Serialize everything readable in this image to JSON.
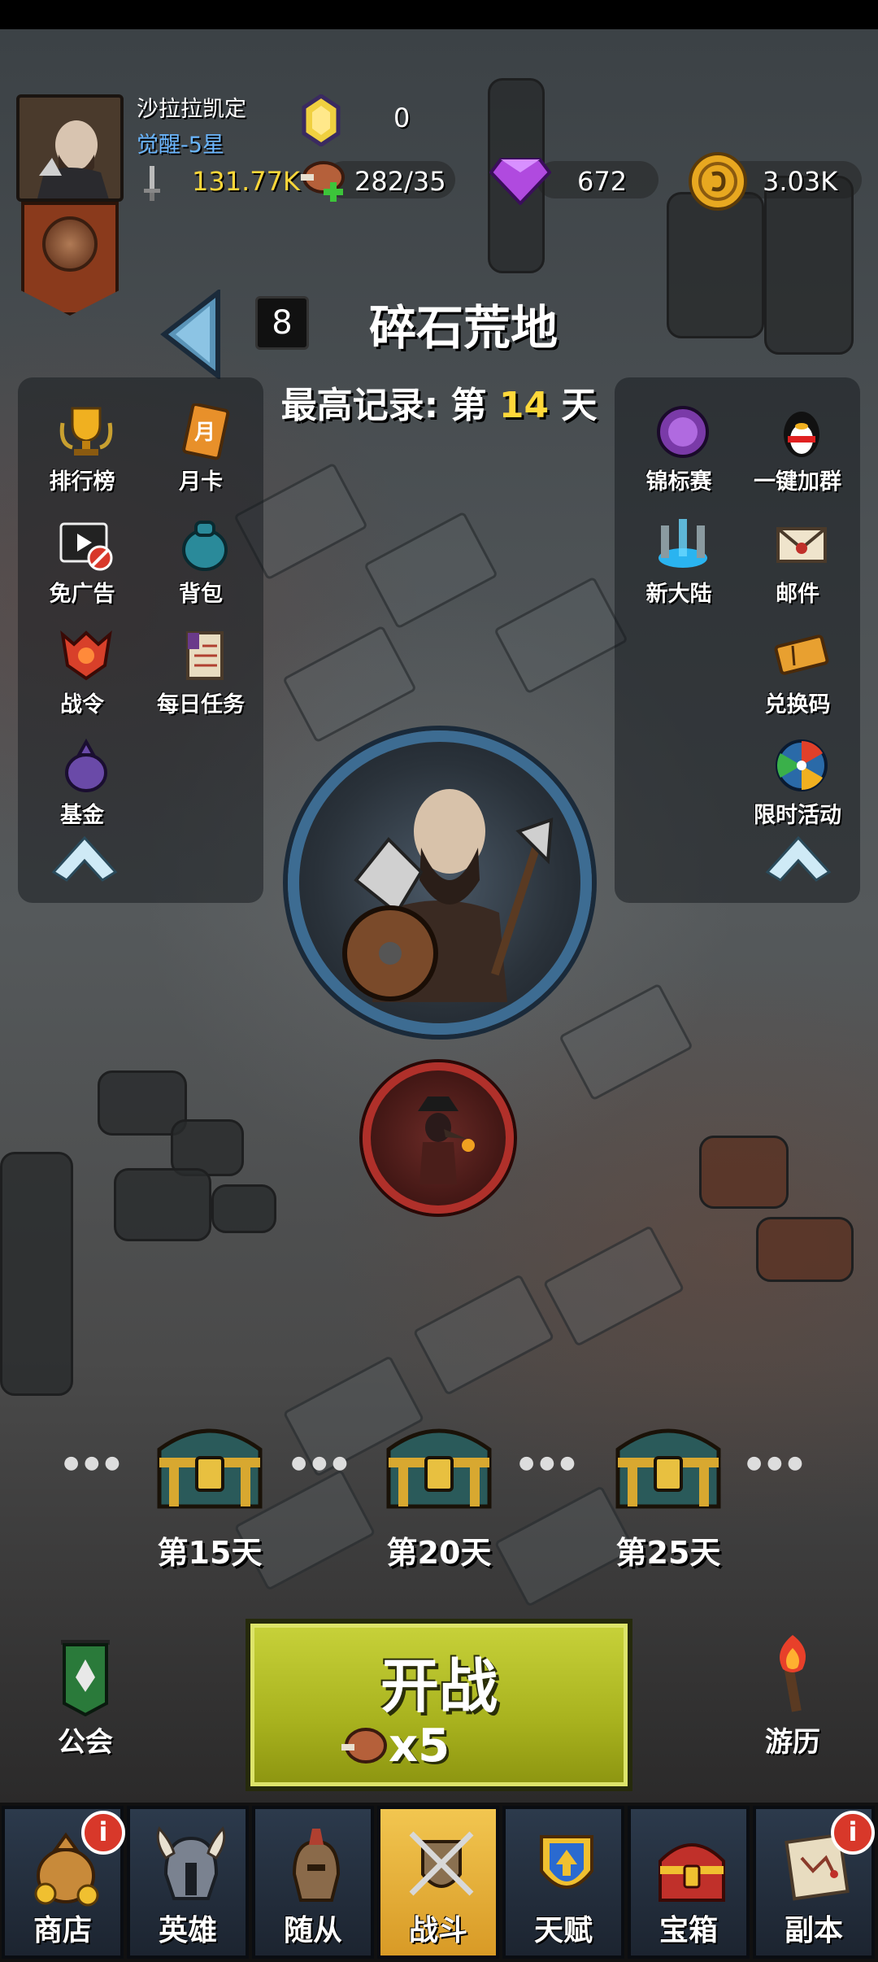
{
  "player": {
    "name": "沙拉拉凯定",
    "rank": "觉醒-5星"
  },
  "resources": {
    "gem_count": "0",
    "power": "131.77K",
    "stamina": "282/35",
    "diamonds": "672",
    "gold": "3.03K"
  },
  "stage": {
    "number": "8",
    "name": "碎石荒地",
    "record_prefix": "最高记录: 第",
    "record_day": "14",
    "record_suffix": "天"
  },
  "left_menu": [
    {
      "label": "排行榜",
      "icon": "trophy-icon"
    },
    {
      "label": "月卡",
      "icon": "month-card-icon"
    },
    {
      "label": "免广告",
      "icon": "no-ads-icon"
    },
    {
      "label": "背包",
      "icon": "backpack-icon"
    },
    {
      "label": "战令",
      "icon": "battle-pass-icon"
    },
    {
      "label": "每日任务",
      "icon": "daily-quest-icon"
    },
    {
      "label": "基金",
      "icon": "fund-bag-icon"
    }
  ],
  "right_menu": [
    {
      "label": "锦标赛",
      "icon": "tournament-icon"
    },
    {
      "label": "一键加群",
      "icon": "qq-penguin-icon"
    },
    {
      "label": "新大陆",
      "icon": "portal-icon"
    },
    {
      "label": "邮件",
      "icon": "mail-icon"
    },
    {
      "label": "兑换码",
      "icon": "ticket-icon"
    },
    {
      "label": "限时活动",
      "icon": "event-wheel-icon"
    }
  ],
  "chests": [
    {
      "label": "第15天"
    },
    {
      "label": "第20天"
    },
    {
      "label": "第25天"
    }
  ],
  "battle": {
    "title": "开战",
    "cost": "x5"
  },
  "guild": {
    "label": "公会"
  },
  "travel": {
    "label": "游历"
  },
  "nav": [
    {
      "label": "商店",
      "badge": "i"
    },
    {
      "label": "英雄",
      "badge": ""
    },
    {
      "label": "随从",
      "badge": ""
    },
    {
      "label": "战斗",
      "badge": ""
    },
    {
      "label": "天赋",
      "badge": ""
    },
    {
      "label": "宝箱",
      "badge": ""
    },
    {
      "label": "副本",
      "badge": "i"
    }
  ],
  "colors": {
    "accent_gold": "#ffd83a",
    "rank_blue": "#6ab6ff",
    "battle_green": "#c8d23a",
    "active_tab": "#f2c650"
  }
}
